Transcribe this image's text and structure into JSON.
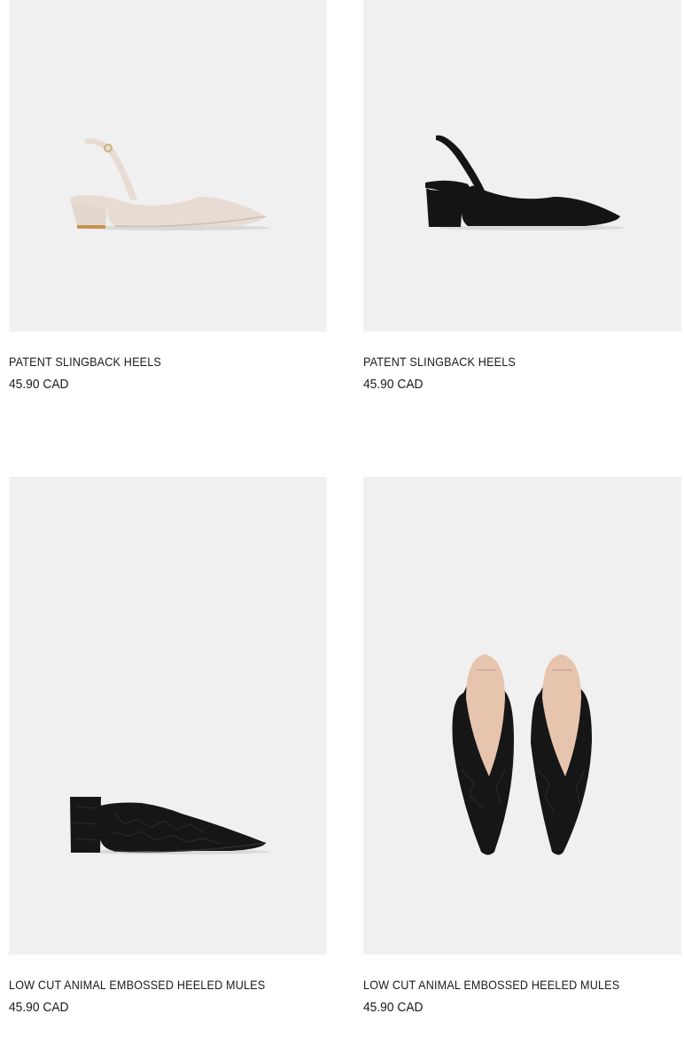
{
  "currency": "CAD",
  "products": [
    {
      "name": "PATENT SLINGBACK HEELS",
      "price": "45.90 CAD",
      "icon": "nude-slingback-heel-image",
      "color": "#e7dcd3"
    },
    {
      "name": "PATENT SLINGBACK HEELS",
      "price": "45.90 CAD",
      "icon": "black-slingback-heel-image",
      "color": "#141414"
    },
    {
      "name": "LOW CUT ANIMAL EMBOSSED HEELED MULES",
      "price": "45.90 CAD",
      "icon": "black-mule-side-image",
      "color": "#161616"
    },
    {
      "name": "LOW CUT ANIMAL EMBOSSED HEELED MULES",
      "price": "45.90 CAD",
      "icon": "black-mules-top-image",
      "color": "#161616"
    }
  ]
}
